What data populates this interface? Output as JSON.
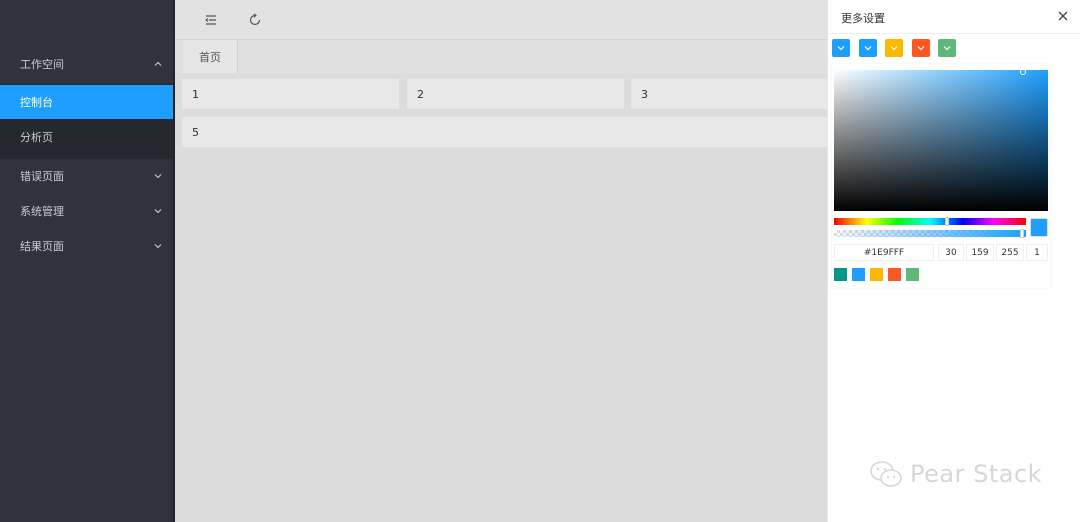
{
  "sidebar": {
    "items": [
      {
        "label": "工作空间",
        "expanded": true
      },
      {
        "label": "控制台",
        "active": true
      },
      {
        "label": "分析页"
      },
      {
        "label": "错误页面"
      },
      {
        "label": "系统管理"
      },
      {
        "label": "结果页面"
      }
    ]
  },
  "header": {
    "icons": [
      "menu-fold-icon",
      "refresh-icon"
    ]
  },
  "tabs": {
    "home": "首页"
  },
  "cards": [
    "1",
    "2",
    "3",
    "5"
  ],
  "panel": {
    "title": "更多设置",
    "theme_swatches": [
      "#1e9fff",
      "#1e9fff",
      "#ffb800",
      "#ff5722",
      "#5fb878"
    ],
    "picker": {
      "hex": "#1E9FFF",
      "r": "30",
      "g": "159",
      "b": "255",
      "a": "1",
      "color": "#1e9fff"
    },
    "presets": [
      "#009688",
      "#1e9fff",
      "#ffb800",
      "#ff5722",
      "#5fb878"
    ]
  },
  "watermark": {
    "text": "Pear Stack"
  }
}
